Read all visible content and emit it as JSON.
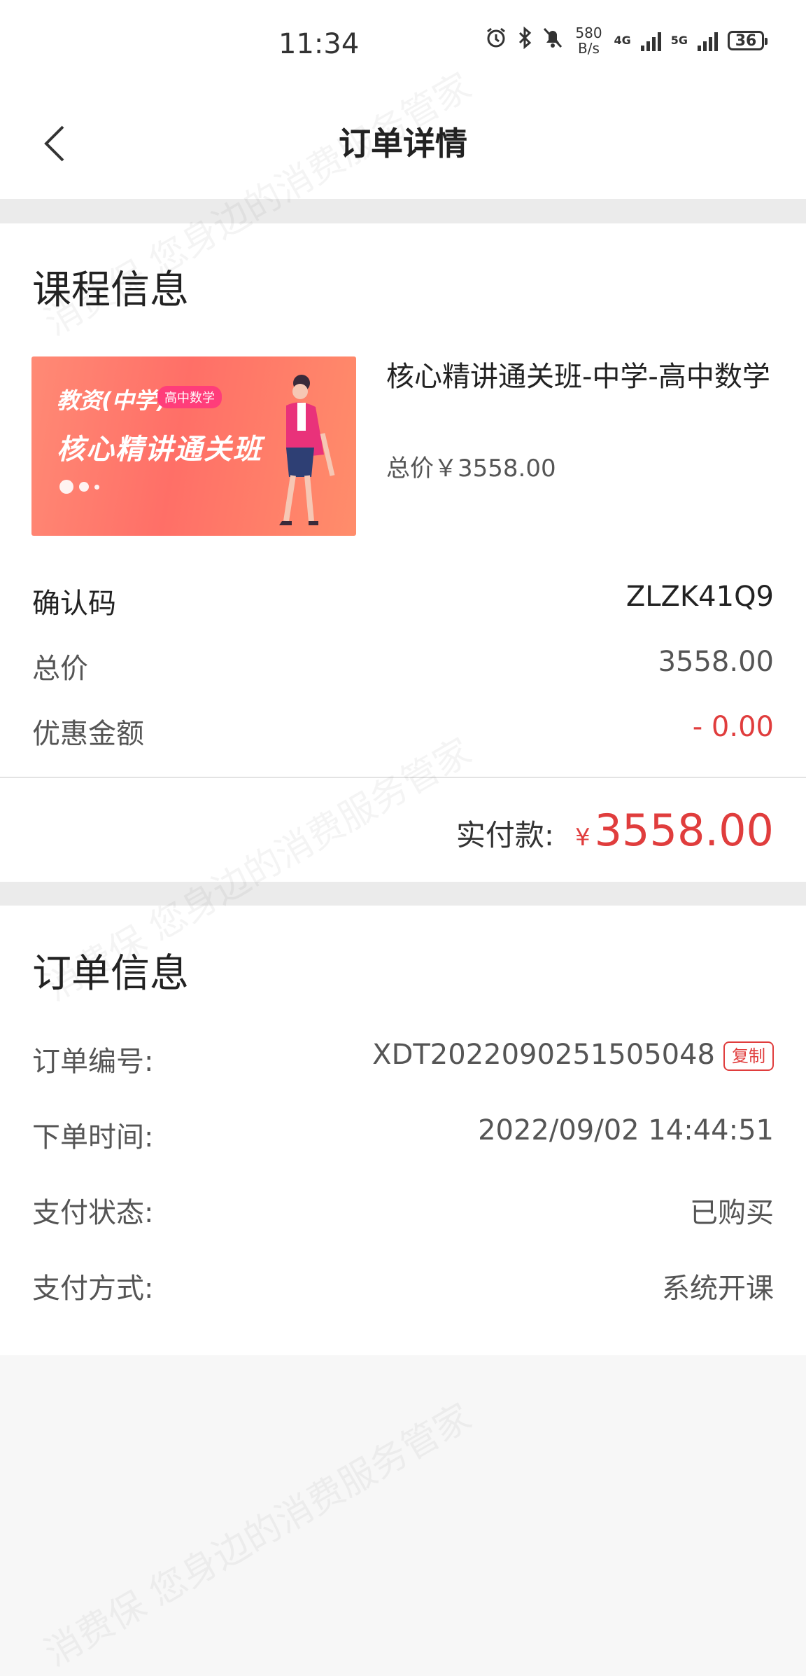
{
  "status_bar": {
    "time": "11:34",
    "speed_value": "580",
    "speed_unit": "B/s",
    "net1": "4G",
    "net2": "5G",
    "battery": "36"
  },
  "nav": {
    "title": "订单详情"
  },
  "course_section": {
    "title": "课程信息",
    "thumbnail": {
      "tag": "教资(中学)",
      "badge": "高中数学",
      "main": "核心精讲通关班"
    },
    "name": "核心精讲通关班-中学-高中数学",
    "total_price": "总价￥3558.00",
    "confirm_code_label": "确认码",
    "confirm_code": "ZLZK41Q9",
    "total_label": "总价",
    "total_value": "3558.00",
    "discount_label": "优惠金额",
    "discount_value": "- 0.00",
    "paid_label": "实付款:",
    "paid_currency": "¥",
    "paid_amount": "3558.00"
  },
  "order_section": {
    "title": "订单信息",
    "order_no_label": "订单编号:",
    "order_no": "XDT2022090251505048",
    "copy_label": "复制",
    "order_time_label": "下单时间:",
    "order_time": "2022/09/02 14:44:51",
    "pay_status_label": "支付状态:",
    "pay_status": "已购买",
    "pay_method_label": "支付方式:",
    "pay_method": "系统开课"
  },
  "watermark": "消费保 您身边的消费服务管家",
  "colors": {
    "accent_red": "#e03d3d",
    "divider_gray": "#ebebeb"
  }
}
